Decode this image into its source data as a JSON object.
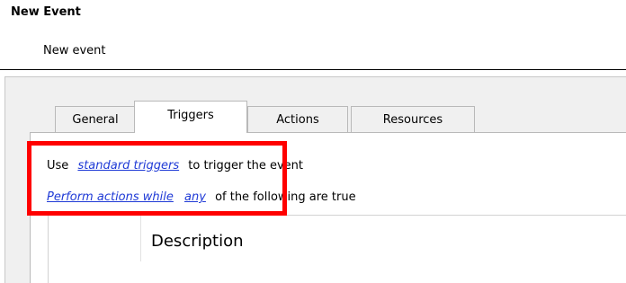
{
  "header": {
    "title": "New Event",
    "subtitle": "New event"
  },
  "tabs": [
    {
      "label": "General",
      "active": false
    },
    {
      "label": "Triggers",
      "active": true
    },
    {
      "label": "Actions",
      "active": false
    },
    {
      "label": "Resources",
      "active": false
    }
  ],
  "triggers": {
    "line1": {
      "prefix": "Use",
      "link": "standard triggers",
      "suffix": "to trigger the event"
    },
    "line2": {
      "link1": "Perform actions while",
      "link2": "any",
      "suffix": "of the following are true"
    }
  },
  "list": {
    "column_header": "Description"
  },
  "colors": {
    "link": "#1f3ad6",
    "highlight": "#ff0000",
    "panel": "#f0f0f0"
  }
}
